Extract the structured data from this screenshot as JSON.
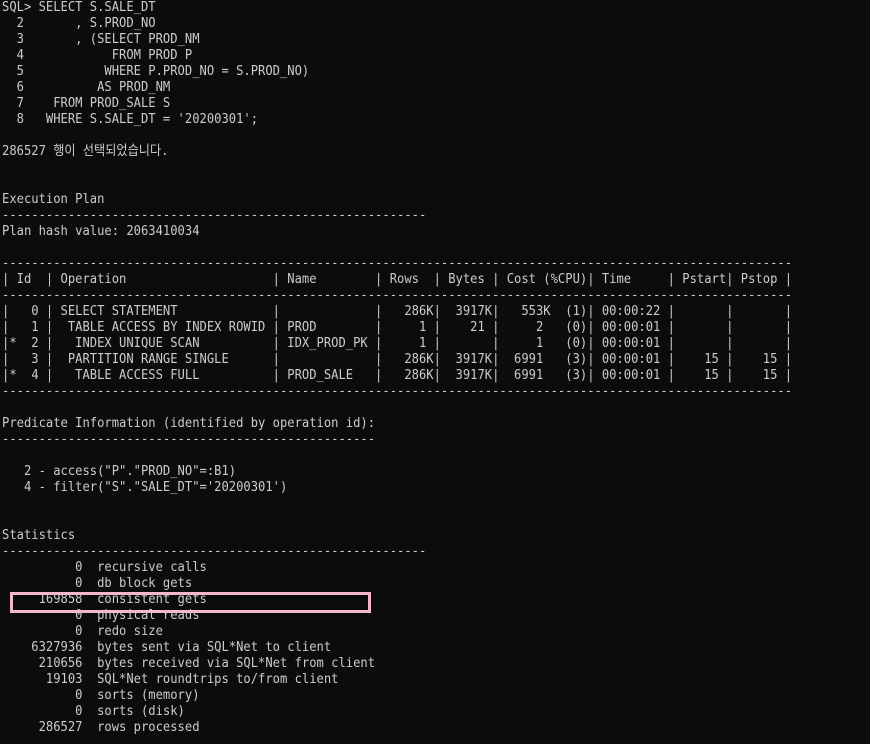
{
  "lines": [
    "SQL> SELECT S.SALE_DT",
    "  2       , S.PROD_NO",
    "  3       , (SELECT PROD_NM",
    "  4            FROM PROD P",
    "  5           WHERE P.PROD_NO = S.PROD_NO)",
    "  6          AS PROD_NM",
    "  7    FROM PROD_SALE S",
    "  8   WHERE S.SALE_DT = '20200301';",
    "",
    "286527 행이 선택되었습니다.",
    "",
    "",
    "Execution Plan",
    "----------------------------------------------------------",
    "Plan hash value: 2063410034",
    "",
    "------------------------------------------------------------------------------------------------------------",
    "| Id  | Operation                    | Name        | Rows  | Bytes | Cost (%CPU)| Time     | Pstart| Pstop |",
    "------------------------------------------------------------------------------------------------------------",
    "|   0 | SELECT STATEMENT             |             |   286K|  3917K|   553K  (1)| 00:00:22 |       |       |",
    "|   1 |  TABLE ACCESS BY INDEX ROWID | PROD        |     1 |    21 |     2   (0)| 00:00:01 |       |       |",
    "|*  2 |   INDEX UNIQUE SCAN          | IDX_PROD_PK |     1 |       |     1   (0)| 00:00:01 |       |       |",
    "|   3 |  PARTITION RANGE SINGLE      |             |   286K|  3917K|  6991   (3)| 00:00:01 |    15 |    15 |",
    "|*  4 |   TABLE ACCESS FULL          | PROD_SALE   |   286K|  3917K|  6991   (3)| 00:00:01 |    15 |    15 |",
    "------------------------------------------------------------------------------------------------------------",
    "",
    "Predicate Information (identified by operation id):",
    "---------------------------------------------------",
    "",
    "   2 - access(\"P\".\"PROD_NO\"=:B1)",
    "   4 - filter(\"S\".\"SALE_DT\"='20200301')",
    "",
    "",
    "Statistics",
    "----------------------------------------------------------",
    "          0  recursive calls",
    "          0  db block gets",
    "     169858  consistent gets",
    "          0  physical reads",
    "          0  redo size",
    "    6327936  bytes sent via SQL*Net to client",
    "     210656  bytes received via SQL*Net from client",
    "      19103  SQL*Net roundtrips to/from client",
    "          0  sorts (memory)",
    "          0  sorts (disk)",
    "     286527  rows processed"
  ]
}
